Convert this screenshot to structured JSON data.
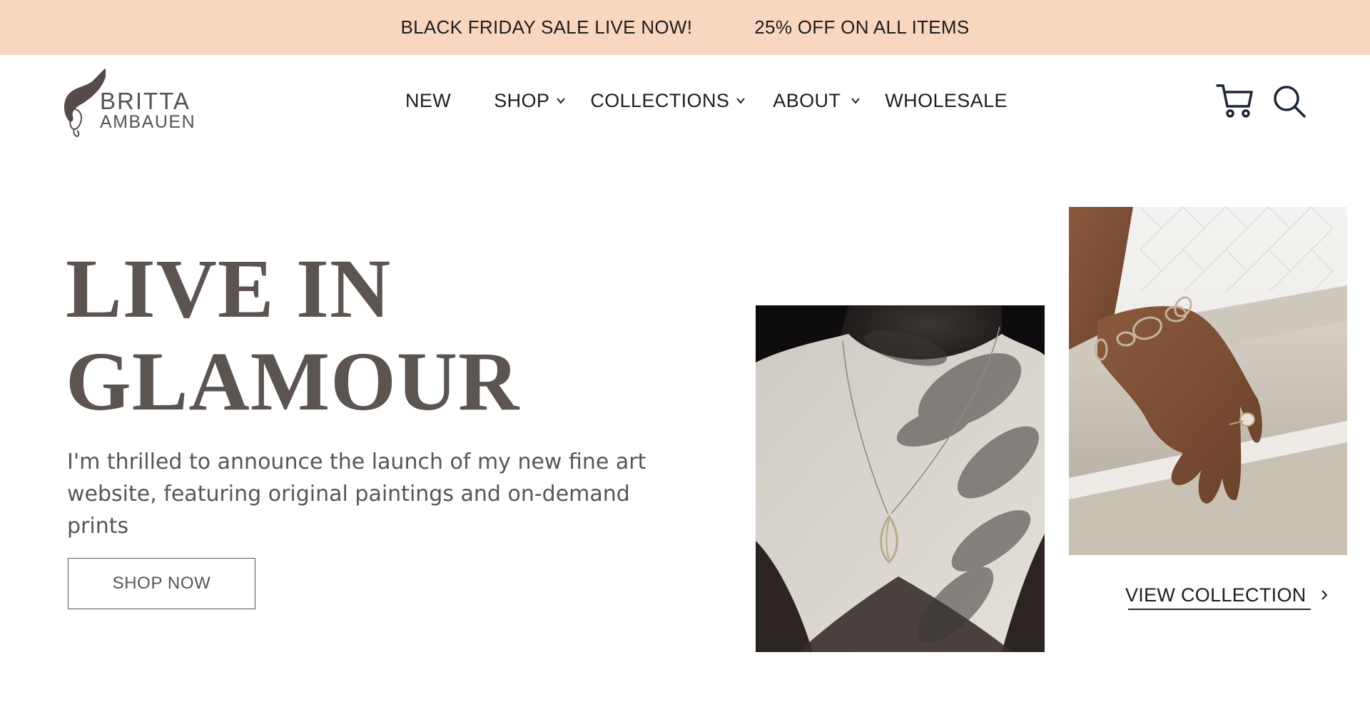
{
  "announcement": {
    "left": "BLACK FRIDAY SALE LIVE NOW!",
    "right": "25% OFF ON ALL ITEMS",
    "bg_color": "#f8d6c0"
  },
  "logo": {
    "line1": "BRITTA",
    "line2": "AMBAUEN"
  },
  "nav": {
    "items": [
      {
        "label": "NEW"
      },
      {
        "label": "SHOP"
      },
      {
        "label": "COLLECTIONS"
      },
      {
        "label": "ABOUT"
      },
      {
        "label": "WHOLESALE"
      }
    ]
  },
  "icons": {
    "cart": "cart-icon",
    "search": "search-icon"
  },
  "hero": {
    "title_line1": "LIVE IN",
    "title_line2": "GLAMOUR",
    "description": "I'm thrilled to announce the launch of my new fine art website, featuring original paintings and on-demand prints",
    "cta_label": "SHOP NOW",
    "text_color": "#5b5451"
  },
  "collection_link": {
    "label": "VIEW COLLECTION"
  }
}
